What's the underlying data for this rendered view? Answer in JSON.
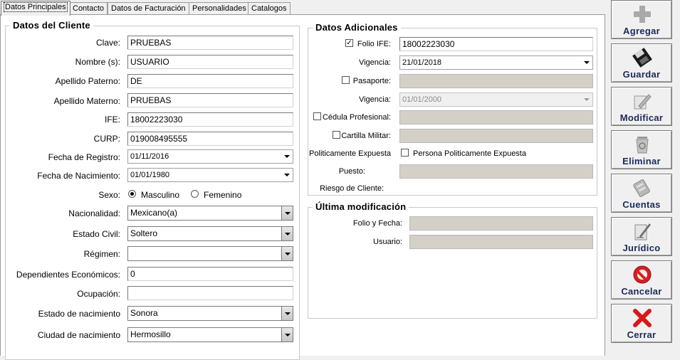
{
  "tabs": [
    {
      "label": "Datos Principales",
      "active": true
    },
    {
      "label": "Contacto"
    },
    {
      "label": "Datos de Facturación"
    },
    {
      "label": "Personalidades"
    },
    {
      "label": "Catalogos"
    }
  ],
  "cliente": {
    "title": "Datos del Cliente",
    "clave_label": "Clave:",
    "clave": "PRUEBAS",
    "nombre_label": "Nombre (s):",
    "nombre": "USUARIO",
    "ap_paterno_label": "Apellido Paterno:",
    "ap_paterno": "DE",
    "ap_materno_label": "Apellido Materno:",
    "ap_materno": "PRUEBAS",
    "ife_label": "IFE:",
    "ife": "18002223030",
    "curp_label": "CURP:",
    "curp": "019008495555",
    "fecha_registro_label": "Fecha de Registro:",
    "fecha_registro": "01/11/2016",
    "fecha_nacimiento_label": "Fecha de Nacimiento:",
    "fecha_nacimiento": "01/01/1980",
    "sexo_label": "Sexo:",
    "sexo_masculino": "Masculino",
    "sexo_femenino": "Femenino",
    "nacionalidad_label": "Nacionalidad:",
    "nacionalidad": "Mexicano(a)",
    "estado_civil_label": "Estado Civil:",
    "estado_civil": "Soltero",
    "regimen_label": "Régimen:",
    "regimen": "",
    "dependientes_label": "Dependientes Económicos:",
    "dependientes": "0",
    "ocupacion_label": "Ocupación:",
    "ocupacion": "",
    "estado_nac_label": "Estado de nacimiento",
    "estado_nac": "Sonora",
    "ciudad_nac_label": "Ciudad de nacimiento",
    "ciudad_nac": "Hermosillo"
  },
  "adicionales": {
    "title": "Datos Adicionales",
    "folio_ife_label": "Folio IFE:",
    "folio_ife": "18002223030",
    "vigencia_label": "Vigencia:",
    "vigencia": "21/01/2018",
    "pasaporte_label": "Pasaporte:",
    "pasaporte": "",
    "vigencia2_label": "Vigencia:",
    "vigencia2": "01/01/2000",
    "cedula_label": "Cédula Profesional:",
    "cedula": "",
    "cartilla_label": "Cartilla Militar:",
    "cartilla": "",
    "pep_label": "Politicamente Expuesta",
    "pep_check": "Persona Politicamente Expuesta",
    "puesto_label": "Puesto:",
    "puesto": "",
    "riesgo_label": "Riesgo de Cliente:"
  },
  "ultima": {
    "title": "Última modificación",
    "folio_fecha_label": "Folio y Fecha:",
    "folio_fecha": "",
    "usuario_label": "Usuario:",
    "usuario": ""
  },
  "actions": [
    {
      "label": "Agregar",
      "icon": "plus-icon"
    },
    {
      "label": "Guardar",
      "icon": "floppy-disk-icon"
    },
    {
      "label": "Modificar",
      "icon": "edit-pencil-icon"
    },
    {
      "label": "Eliminar",
      "icon": "recycle-bin-icon"
    },
    {
      "label": "Cuentas",
      "icon": "accounts-icon"
    },
    {
      "label": "Jurídico",
      "icon": "legal-document-icon"
    },
    {
      "label": "Cancelar",
      "icon": "cancel-icon"
    },
    {
      "label": "Cerrar",
      "icon": "close-x-icon"
    }
  ]
}
